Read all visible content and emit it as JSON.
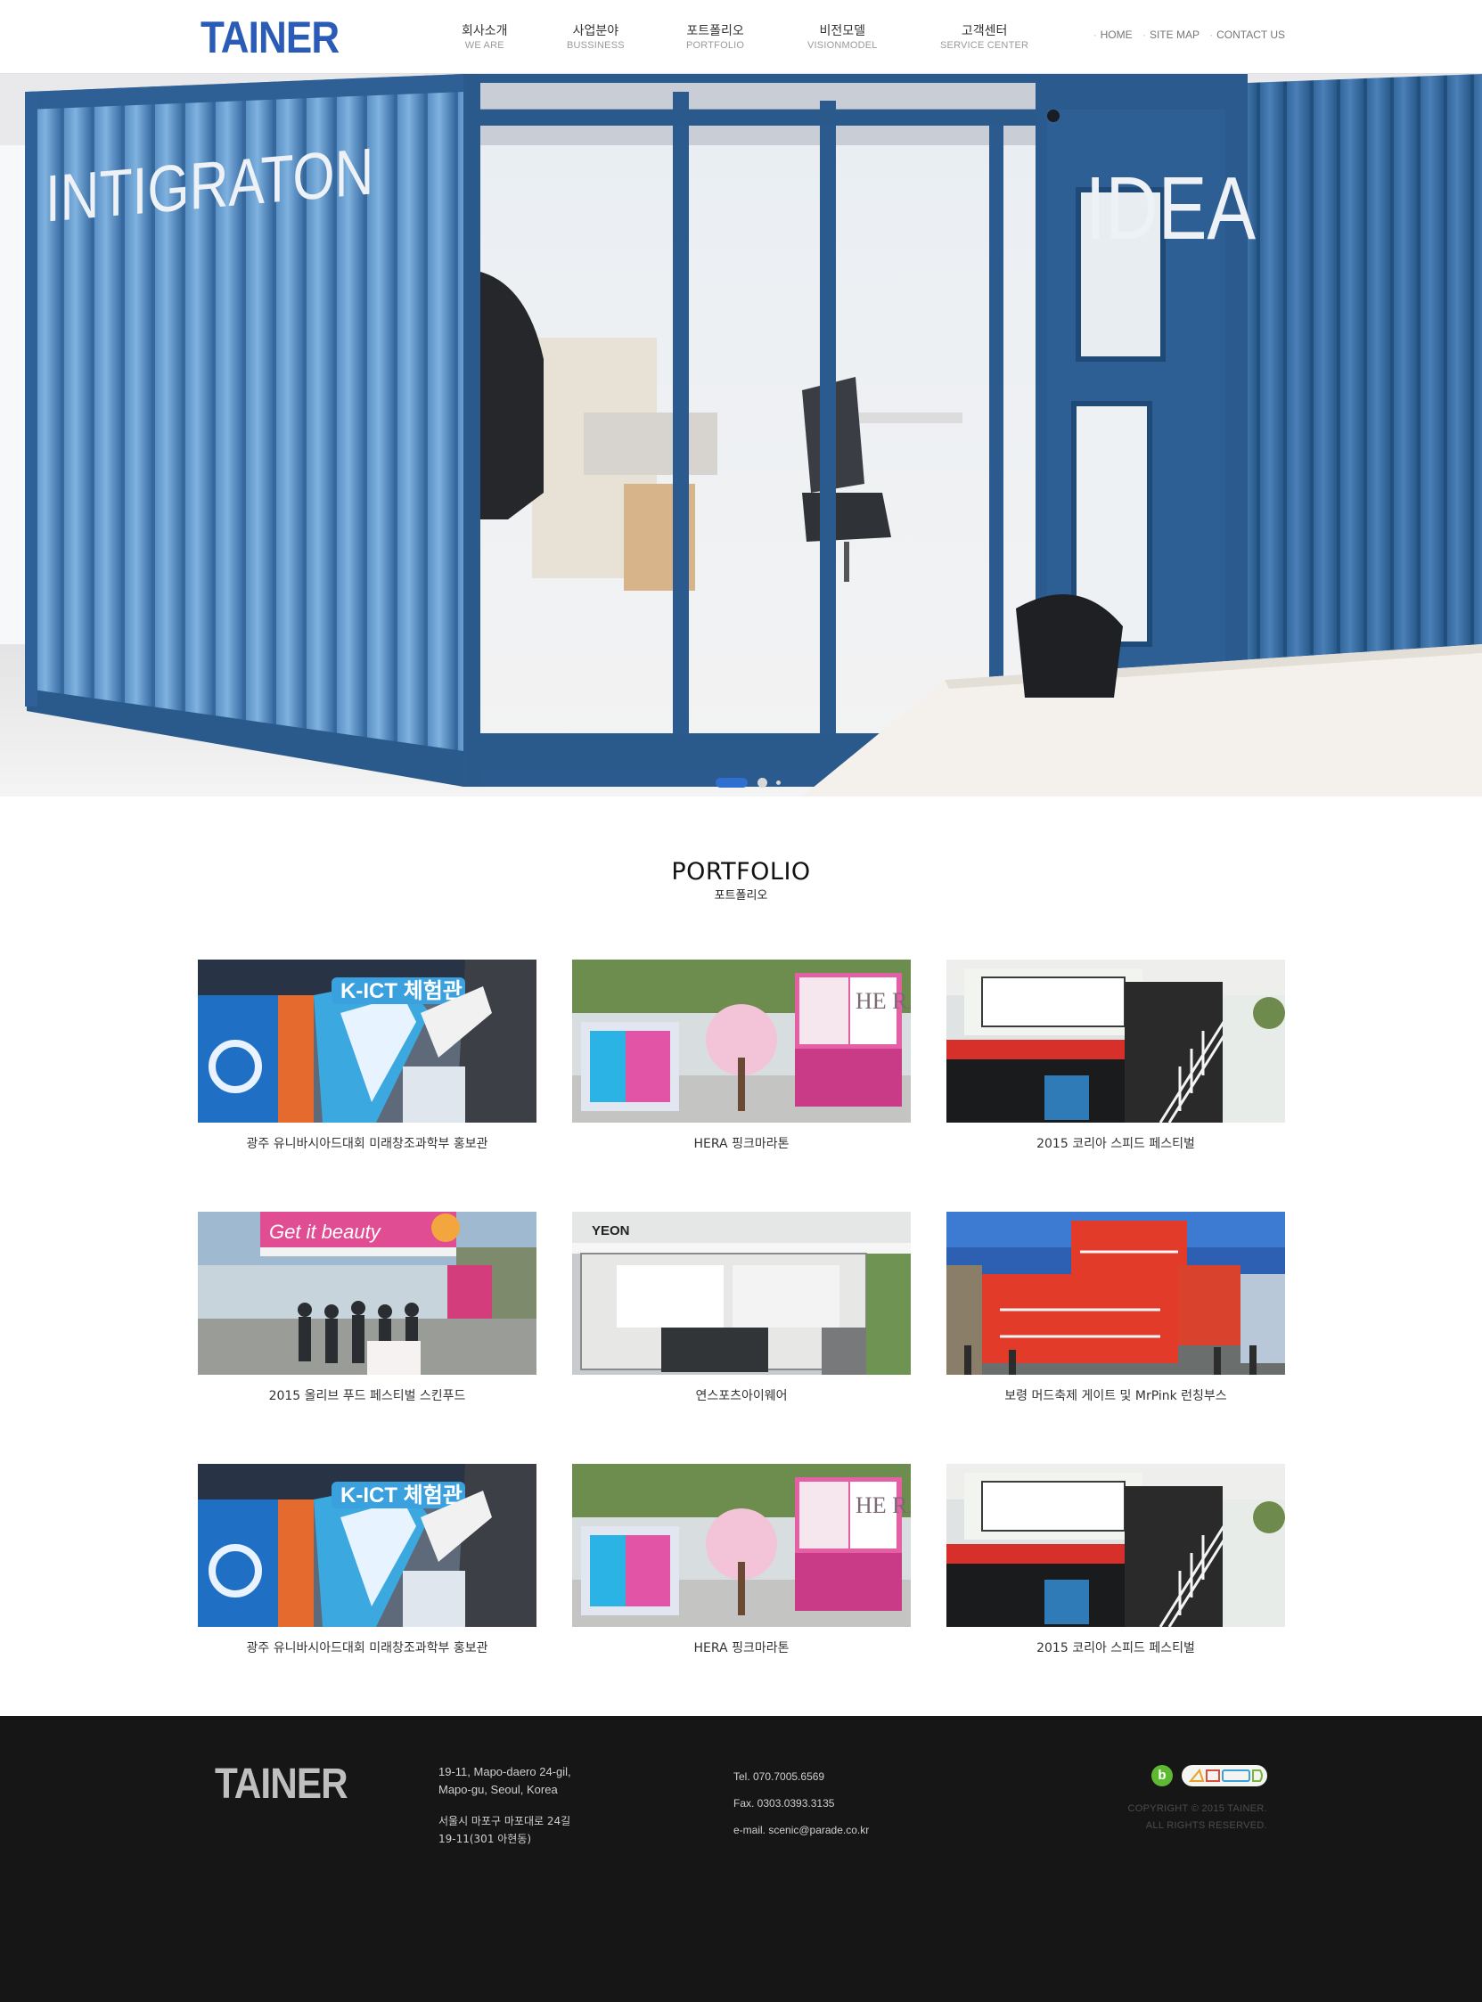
{
  "brand": {
    "logo_text": "TAINER",
    "logo_color": "#2a5bb7"
  },
  "nav": {
    "items": [
      {
        "ko": "회사소개",
        "en": "WE ARE"
      },
      {
        "ko": "사업분야",
        "en": "BUSSINESS"
      },
      {
        "ko": "포트폴리오",
        "en": "PORTFOLIO"
      },
      {
        "ko": "비전모델",
        "en": "VISIONMODEL"
      },
      {
        "ko": "고객센터",
        "en": "SERVICE CENTER"
      }
    ]
  },
  "util_links": {
    "home": "HOME",
    "sitemap": "SITE MAP",
    "contact": "CONTACT US"
  },
  "hero": {
    "sign_left": "INTIGRATON",
    "sign_right": "IDEA",
    "slide_count": 3,
    "active_slide": 1,
    "accent": "#2f6fd0"
  },
  "portfolio": {
    "title": "PORTFOLIO",
    "subtitle": "포트폴리오",
    "items": [
      {
        "caption": "광주 유니바시아드대회 미래창조과학부 홍보관",
        "thumb_icon": "k-ict-pavilion-photo",
        "sign": "K-ICT 체험관"
      },
      {
        "caption": "HERA 핑크마라톤",
        "thumb_icon": "hera-pink-booth-photo",
        "sign": "HE RA"
      },
      {
        "caption": "2015 코리아 스피드 페스티벌",
        "thumb_icon": "speed-festival-booth-photo"
      },
      {
        "caption": "2015 올리브 푸드 페스티벌 스킨푸드",
        "thumb_icon": "skinfood-booth-photo",
        "sign": "Get it beauty"
      },
      {
        "caption": "연스포츠아이웨어",
        "thumb_icon": "yeon-eyewear-shop-photo",
        "sign": "YEON"
      },
      {
        "caption": "보령 머드축제 게이트 및 MrPink 런칭부스",
        "thumb_icon": "mud-festival-gate-photo"
      },
      {
        "caption": "광주 유니바시아드대회 미래창조과학부 홍보관",
        "thumb_icon": "k-ict-pavilion-photo",
        "sign": "K-ICT 체험관"
      },
      {
        "caption": "HERA 핑크마라톤",
        "thumb_icon": "hera-pink-booth-photo",
        "sign": "HE RA"
      },
      {
        "caption": "2015 코리아 스피드 페스티벌",
        "thumb_icon": "speed-festival-booth-photo"
      }
    ]
  },
  "footer": {
    "logo_text": "TAINER",
    "addr_en_1": "19-11, Mapo-daero 24-gil,",
    "addr_en_2": "Mapo-gu, Seoul, Korea",
    "addr_ko_1": "서울시 마포구 마포대로 24길",
    "addr_ko_2": "19-11(301 아현동)",
    "tel": "Tel. 070.7005.6569",
    "fax": "Fax. 0303.0393.3135",
    "email": "e-mail. scenic@parade.co.kr",
    "badge_b": "b",
    "copyright_1": "COPYRIGHT © 2015 TAINER.",
    "copyright_2": "ALL RIGHTS RESERVED."
  }
}
